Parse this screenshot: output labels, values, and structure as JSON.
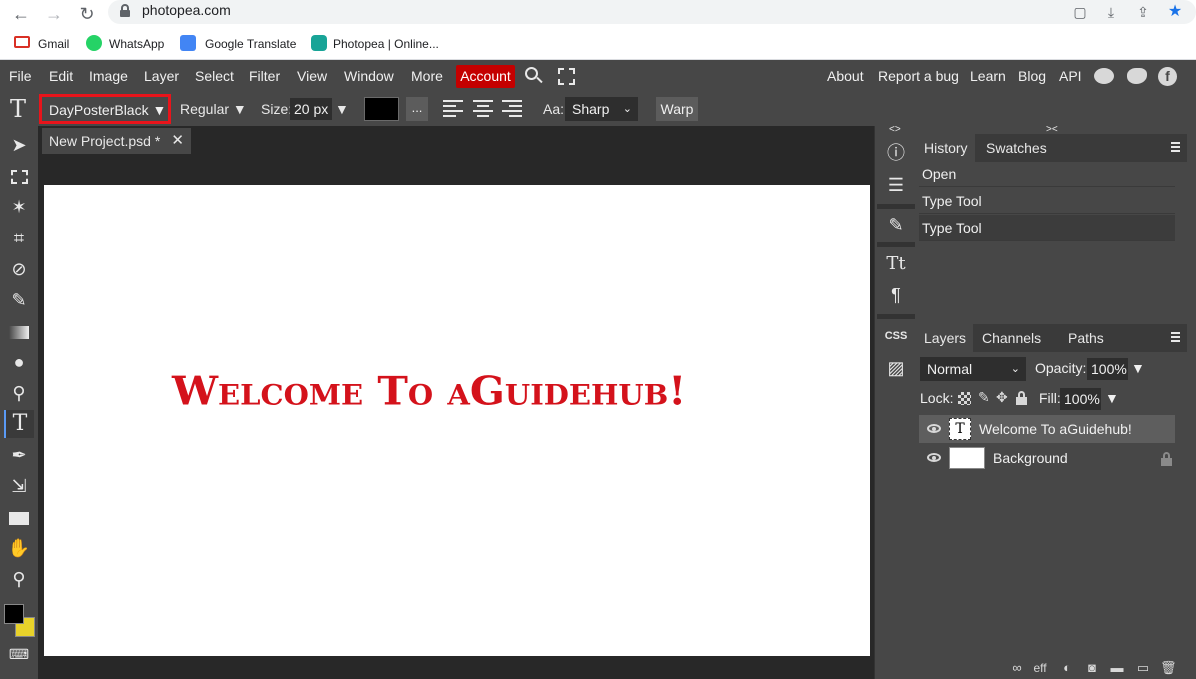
{
  "browser": {
    "url": "photopea.com",
    "bookmarks": [
      "Gmail",
      "WhatsApp",
      "Google Translate",
      "Photopea | Online..."
    ]
  },
  "menu": {
    "items": [
      "File",
      "Edit",
      "Image",
      "Layer",
      "Select",
      "Filter",
      "View",
      "Window",
      "More"
    ],
    "account": "Account",
    "right_links": [
      "About",
      "Report a bug",
      "Learn",
      "Blog",
      "API"
    ]
  },
  "options": {
    "font": "DayPosterBlack ▼",
    "style": "Regular ▼",
    "size_label": "Size:",
    "size_value": "20 px",
    "size_arrow": "▼",
    "dots": "...",
    "aa_label": "Aa:",
    "aa_value": "Sharp",
    "warp": "Warp",
    "text_color": "#000000",
    "highlight_color": "#e8141b"
  },
  "document": {
    "tab": "New Project.psd *",
    "canvas_text": "Welcome To aGuidehub!",
    "text_color": "#d4121b"
  },
  "mini_panel": {
    "css_label": "CSS"
  },
  "history_panel": {
    "tabs": [
      "History",
      "Swatches"
    ],
    "rows": [
      "Open",
      "Type Tool",
      "Type Tool"
    ]
  },
  "layers_panel": {
    "tabs": [
      "Layers",
      "Channels",
      "Paths"
    ],
    "blend_mode": "Normal",
    "opacity_label": "Opacity:",
    "opacity_value": "100%",
    "lock_label": "Lock:",
    "fill_label": "Fill:",
    "fill_value": "100%",
    "layers": [
      "Welcome To aGuidehub!",
      "Background"
    ],
    "fx_label": "eff"
  },
  "colors": {
    "foreground": "#000000",
    "background": "#e8d22a",
    "account_bg": "#c40000"
  }
}
